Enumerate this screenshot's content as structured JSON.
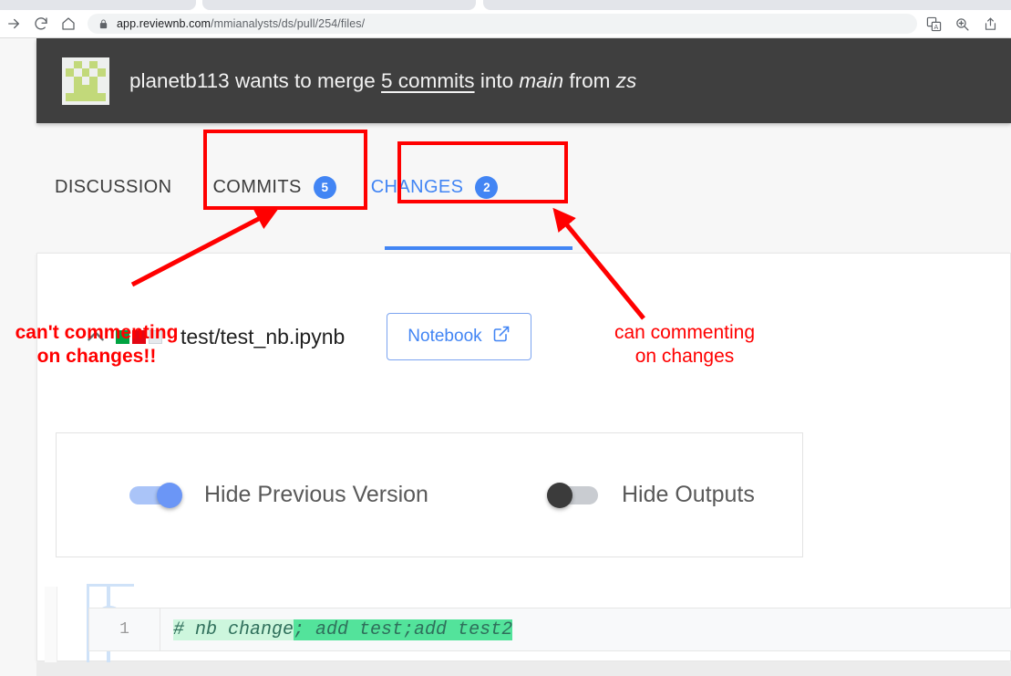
{
  "browser": {
    "url_host": "app.reviewnb.com",
    "url_path": "/mmianalysts/ds/pull/254/files/",
    "icons": {
      "forward": "forward-arrow-icon",
      "reload": "reload-icon",
      "home": "home-icon",
      "lock": "lock-icon",
      "translate": "translate-icon",
      "zoom": "zoom-icon",
      "share": "share-icon"
    }
  },
  "pr_header": {
    "author": "planetb113",
    "action_text": "wants to merge",
    "commits_link": "5 commits",
    "into_text": "into",
    "base_branch": "main",
    "from_text": "from",
    "head_branch": "zs",
    "avatar": "identicon-avatar",
    "background_color": "#3f3f3f"
  },
  "tabs": [
    {
      "label": "DISCUSSION",
      "badge": "",
      "active": false
    },
    {
      "label": "COMMITS",
      "badge": "5",
      "active": false
    },
    {
      "label": "CHANGES",
      "badge": "2",
      "active": true
    }
  ],
  "accent_color": "#4285f4",
  "file": {
    "name": "test/test_nb.ipynb",
    "collapse_icon": "chevron-up-icon",
    "diffstat": [
      "added",
      "deleted",
      "unchanged"
    ],
    "notebook_button": {
      "label": "Notebook",
      "icon": "external-link-icon"
    }
  },
  "toggles": [
    {
      "label": "Hide Previous Version",
      "state": "on"
    },
    {
      "label": "Hide Outputs",
      "state": "off"
    }
  ],
  "diff": {
    "line_number": "1",
    "text_unchanged": "# nb change",
    "text_added": "; add test;add test2",
    "add_comment_icon": "add-comment-plus-icon",
    "colors": {
      "unchanged_bg": "#cdf6dd",
      "added_bg": "#53e39b",
      "text": "#2f6f5b"
    }
  },
  "annotations": {
    "color": "#ff0000",
    "left_note": "can't commenting\non changes!!",
    "right_note": "can commenting\non changes",
    "boxed_tabs": [
      "COMMITS",
      "CHANGES"
    ]
  }
}
